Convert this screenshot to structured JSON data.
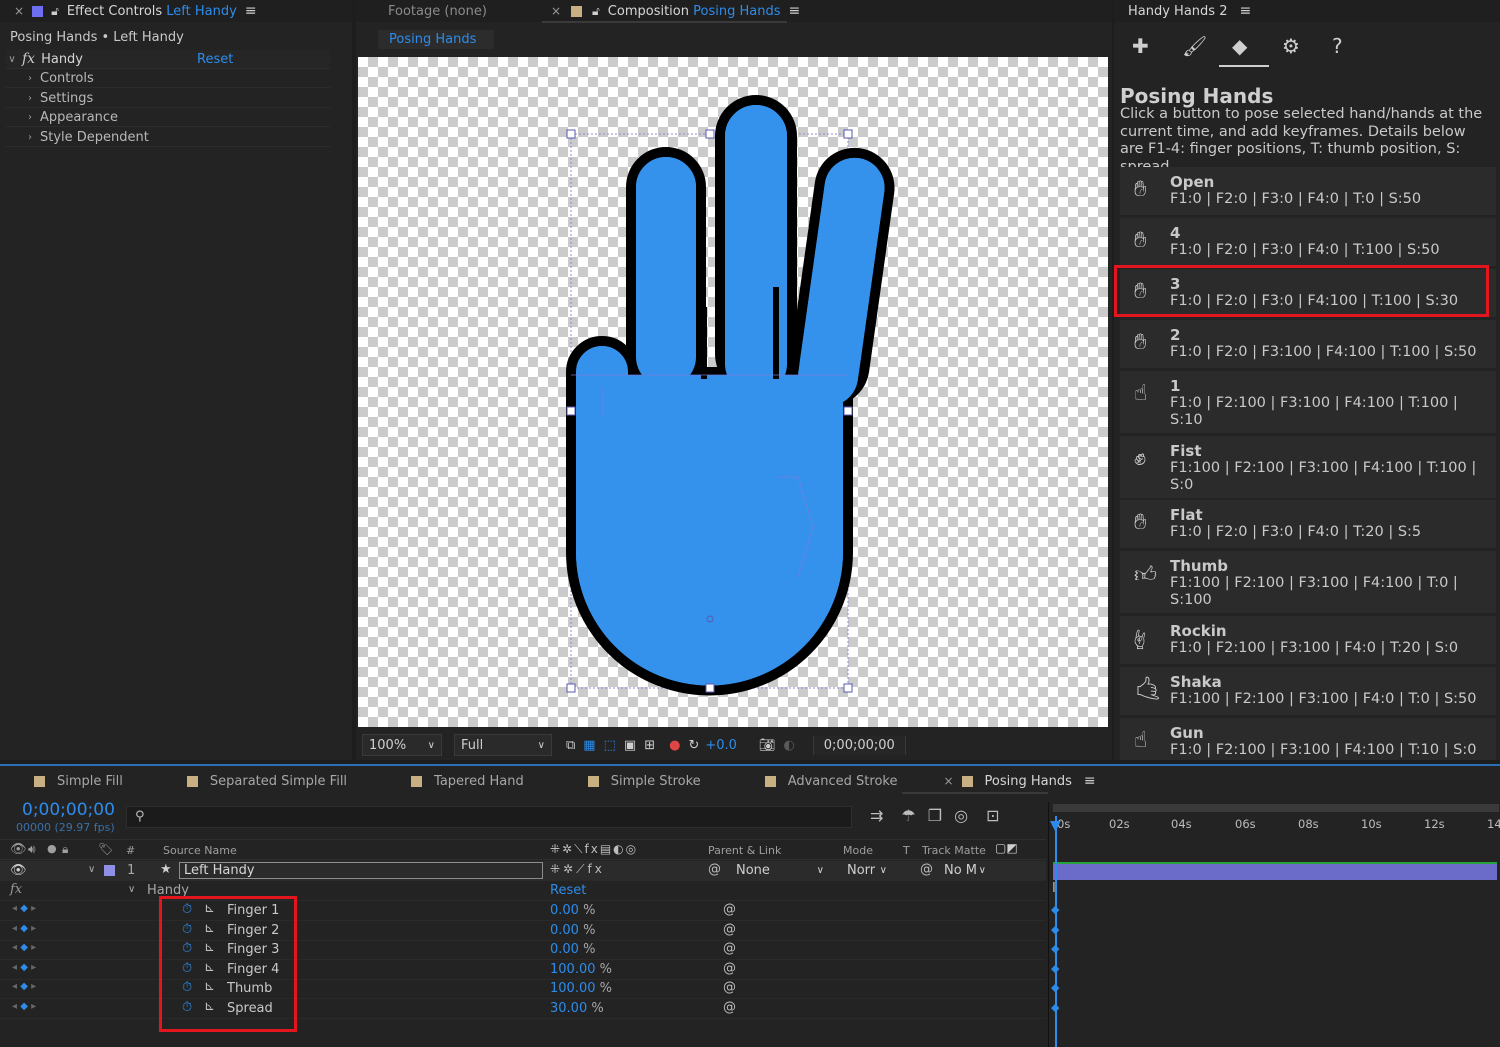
{
  "effect_controls": {
    "tab_label": "Effect Controls",
    "tab_layer": "Left Handy",
    "breadcrumb": "Posing Hands • Left Handy",
    "fx_label": "fx",
    "effect_name": "Handy",
    "reset_label": "Reset",
    "groups": [
      "Controls",
      "Settings",
      "Appearance",
      "Style Dependent"
    ]
  },
  "viewer": {
    "footage_tab": "Footage  (none)",
    "comp_tab_prefix": "Composition",
    "comp_tab_name": "Posing Hands",
    "sub_tab": "Posing Hands",
    "zoom": "100%",
    "resolution": "Full",
    "exposure": "+0.0",
    "timecode": "0;00;00;00"
  },
  "handy_panel": {
    "tab_label": "Handy Hands 2",
    "title": "Posing Hands",
    "description": "Click a button to pose selected hand/hands at the current time, and add keyframes. Details below are F1-4: finger positions, T: thumb position, S: spread.",
    "poses": [
      {
        "name": "Open",
        "desc": "F1:0 | F2:0 | F3:0 | F4:0 | T:0 | S:50"
      },
      {
        "name": "4",
        "desc": "F1:0 | F2:0 | F3:0 | F4:0 | T:100 | S:50"
      },
      {
        "name": "3",
        "desc": "F1:0 | F2:0 | F3:0 | F4:100 | T:100 | S:30"
      },
      {
        "name": "2",
        "desc": "F1:0 | F2:0 | F3:100 | F4:100 | T:100 | S:50"
      },
      {
        "name": "1",
        "desc": "F1:0 | F2:100 | F3:100 | F4:100 | T:100 | S:10"
      },
      {
        "name": "Fist",
        "desc": "F1:100 | F2:100 | F3:100 | F4:100 | T:100 | S:0"
      },
      {
        "name": "Flat",
        "desc": "F1:0 | F2:0 | F3:0 | F4:0 | T:20 | S:5"
      },
      {
        "name": "Thumb",
        "desc": "F1:100 | F2:100 | F3:100 | F4:100 | T:0 | S:100"
      },
      {
        "name": "Rockin",
        "desc": "F1:0 | F2:100 | F3:100 | F4:0 | T:20 | S:0"
      },
      {
        "name": "Shaka",
        "desc": "F1:100 | F2:100 | F3:100 | F4:0 | T:0 | S:50"
      },
      {
        "name": "Gun",
        "desc": "F1:0 | F2:100 | F3:100 | F4:100 | T:10 | S:0"
      }
    ]
  },
  "timeline": {
    "tabs": [
      "Simple Fill",
      "Separated Simple Fill",
      "Tapered Hand",
      "Simple Stroke",
      "Advanced Stroke",
      "Posing Hands"
    ],
    "timecode": "0;00;00;00",
    "frame_info": "00000 (29.97 fps)",
    "col_source_name": "Source Name",
    "col_parent": "Parent & Link",
    "col_mode": "Mode",
    "col_t": "T",
    "col_track_matte": "Track Matte",
    "layer_num": "1",
    "layer_name": "Left Handy",
    "parent_value": "None",
    "mode_value": "Norr",
    "matte_value": "No M",
    "effect_name": "Handy",
    "fx_label": "fx",
    "reset_label": "Reset",
    "properties": [
      {
        "name": "Finger 1",
        "value": "0.00",
        "unit": "%"
      },
      {
        "name": "Finger 2",
        "value": "0.00",
        "unit": "%"
      },
      {
        "name": "Finger 3",
        "value": "0.00",
        "unit": "%"
      },
      {
        "name": "Finger 4",
        "value": "100.00",
        "unit": "%"
      },
      {
        "name": "Thumb",
        "value": "100.00",
        "unit": "%"
      },
      {
        "name": "Spread",
        "value": "30.00",
        "unit": "%"
      }
    ],
    "ruler": [
      "0s",
      "02s",
      "04s",
      "06s",
      "08s",
      "10s",
      "12s",
      "14"
    ]
  },
  "colors": {
    "accent": "#2d8ceb",
    "hand_fill": "#3592ec",
    "highlight_box": "#e3161f",
    "layer_label": "#8f8fe6"
  }
}
